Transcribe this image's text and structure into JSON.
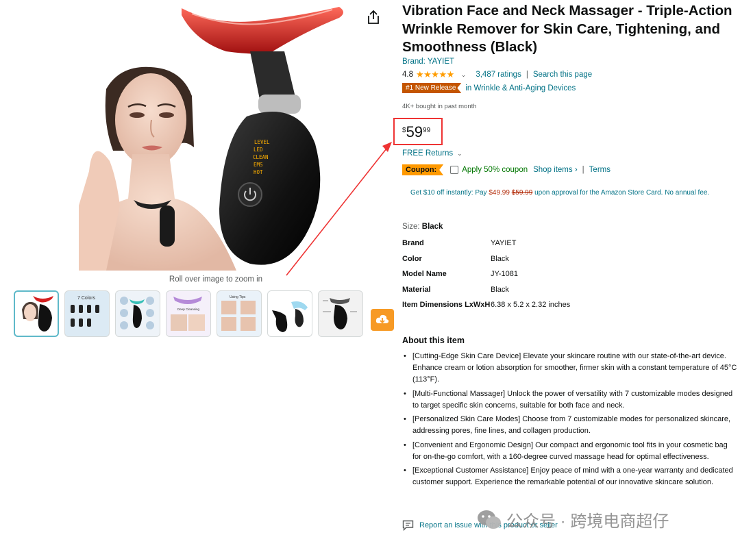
{
  "product": {
    "title": "Vibration Face and Neck Massager - Triple-Action Wrinkle Remover for Skin Care, Tightening, and Smoothness (Black)",
    "brand_label": "Brand: YAYIET",
    "rating_value": "4.8",
    "rating_stars": "★★★★★",
    "ratings_count": "3,487 ratings",
    "search_page": "Search this page",
    "badge": "#1 New Release",
    "badge_category": "in Wrinkle & Anti-Aging Devices",
    "bought": "4K+ bought in past month",
    "price": {
      "currency": "$",
      "whole": "59",
      "fraction": "99"
    },
    "free_returns": "FREE Returns",
    "coupon": {
      "tag": "Coupon:",
      "text": "Apply 50% coupon",
      "shop_items": "Shop items ›",
      "terms": "Terms"
    },
    "card_offer": {
      "prefix": "Get $10 off instantly: Pay ",
      "price": "$49.99",
      "old_price": "$59.99",
      "suffix": " upon approval for the Amazon Store Card. No annual fee."
    },
    "size_label": "Size: ",
    "size_value": "Black",
    "specs": [
      {
        "key": "Brand",
        "value": "YAYIET"
      },
      {
        "key": "Color",
        "value": "Black"
      },
      {
        "key": "Model Name",
        "value": "JY-1081"
      },
      {
        "key": "Material",
        "value": "Black"
      },
      {
        "key": "Item Dimensions LxWxH",
        "value": "6.38 x 5.2 x 2.32 inches"
      }
    ],
    "about_heading": "About this item",
    "bullets": [
      "[Cutting-Edge Skin Care Device] Elevate your skincare routine with our state-of-the-art device. Enhance cream or lotion absorption for smoother, firmer skin with a constant temperature of 45°C (113°F).",
      "[Multi-Functional Massager] Unlock the power of versatility with 7 customizable modes designed to target specific skin concerns, suitable for both face and neck.",
      "[Personalized Skin Care Modes] Choose from 7 customizable modes for personalized skincare, addressing pores, fine lines, and collagen production.",
      "[Convenient and Ergonomic Design] Our compact and ergonomic tool fits in your cosmetic bag for on-the-go comfort, with a 160-degree curved massage head for optimal effectiveness.",
      "[Exceptional Customer Assistance] Enjoy peace of mind with a one-year warranty and dedicated customer support. Experience the remarkable potential of our innovative skincare solution."
    ],
    "report": "Report an issue with this product or seller"
  },
  "media": {
    "zoom_hint": "Roll over image to zoom in",
    "device_modes": [
      "LEVEL",
      "LED",
      "CLEAN",
      "EMS",
      "HOT"
    ],
    "thumbnails": [
      "thumb-1",
      "thumb-2",
      "thumb-3",
      "thumb-4",
      "thumb-5",
      "thumb-6",
      "thumb-7"
    ],
    "thumb2_label": "7 Colors",
    "thumb4_label": "Deep Cleansing",
    "thumb5_label": "Using Tips"
  },
  "watermark": {
    "text": "公众号 · 跨境电商超仔"
  },
  "colors": {
    "link": "#007185",
    "badge": "#c45500",
    "coupon": "#ff9900",
    "price_highlight": "#ee3333",
    "download": "#f79a25"
  }
}
